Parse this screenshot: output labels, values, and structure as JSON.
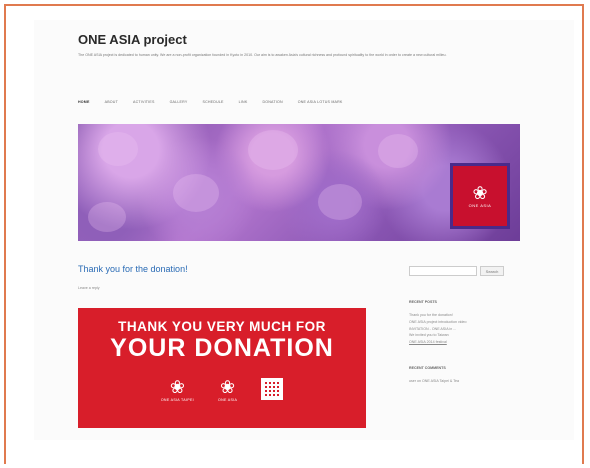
{
  "site": {
    "title": "ONE ASIA project",
    "tagline": "The ONE ASIA project is dedicated to human unity. We are a non-profit organization founded in Kyoto in 2010. Our aim is to awaken Asia's cultural richness and profound spirituality to the world in order to create a new cultural milieu."
  },
  "nav": {
    "items": [
      "HOME",
      "ABOUT",
      "ACTIVITIES",
      "GALLERY",
      "SCHEDULE",
      "LINK",
      "DONATION",
      "ONE ASIA LOTUS MARK"
    ],
    "active_index": 0
  },
  "hero": {
    "logo_glyph": "❀",
    "logo_text": "ONE ASIA"
  },
  "post": {
    "title": "Thank you for the donation!",
    "leave_reply": "Leave a reply"
  },
  "banner": {
    "line1": "THANK YOU VERY MUCH FOR",
    "line2": "YOUR DONATION",
    "icon1_glyph": "❀",
    "icon1_text": "ONE ASIA TAIPEI",
    "icon2_glyph": "❀",
    "icon2_text": "ONE ASIA",
    "colors": {
      "banner": "#d81e2a",
      "logo": "#c8102e",
      "link": "#2a6bb5"
    }
  },
  "sidebar": {
    "search_placeholder": "",
    "search_button": "Search",
    "recent_posts_title": "RECENT POSTS",
    "recent_posts": [
      "Thank you for the donation!",
      "ONE ASIA project introduction video",
      "INVITATION - ONE ASIA in ...",
      "We invited you to Taiwan",
      "ONE ASIA 2014 festival"
    ],
    "recent_comments_title": "RECENT COMMENTS",
    "recent_comment": "user on ONE ASIA Taipei & Tea"
  }
}
